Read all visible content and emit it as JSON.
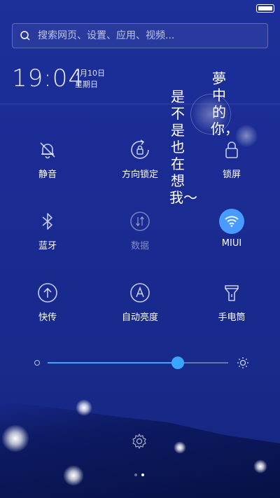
{
  "search": {
    "placeholder": "搜索网页、设置、应用、视频..."
  },
  "clock": {
    "time": "19:04",
    "date": "7月10日",
    "weekday": "星期日"
  },
  "wallpaper": {
    "poem_col1": "夢中的你，",
    "poem_col2": "是不是也在想我〜"
  },
  "toggles": [
    {
      "id": "mute",
      "label": "静音",
      "icon": "bell-off-icon",
      "state": "off"
    },
    {
      "id": "rotation-lock",
      "label": "方向锁定",
      "icon": "rotation-lock-icon",
      "state": "off"
    },
    {
      "id": "lock-screen",
      "label": "锁屏",
      "icon": "lock-icon",
      "state": "off"
    },
    {
      "id": "bluetooth",
      "label": "蓝牙",
      "icon": "bluetooth-icon",
      "state": "off"
    },
    {
      "id": "data",
      "label": "数据",
      "icon": "data-arrows-icon",
      "state": "disabled"
    },
    {
      "id": "wifi",
      "label": "MIUI",
      "icon": "wifi-icon",
      "state": "on"
    },
    {
      "id": "quick-share",
      "label": "快传",
      "icon": "upload-arrow-icon",
      "state": "off"
    },
    {
      "id": "auto-brightness",
      "label": "自动亮度",
      "icon": "auto-brightness-icon",
      "state": "off"
    },
    {
      "id": "flashlight",
      "label": "手电筒",
      "icon": "flashlight-icon",
      "state": "off"
    }
  ],
  "brightness": {
    "level": 0.72
  },
  "pager": {
    "pages": 2,
    "current": 2
  },
  "colors": {
    "accent": "#3aa6ff",
    "wifi_on": "#4a9bff",
    "background": "#1a2b92"
  }
}
